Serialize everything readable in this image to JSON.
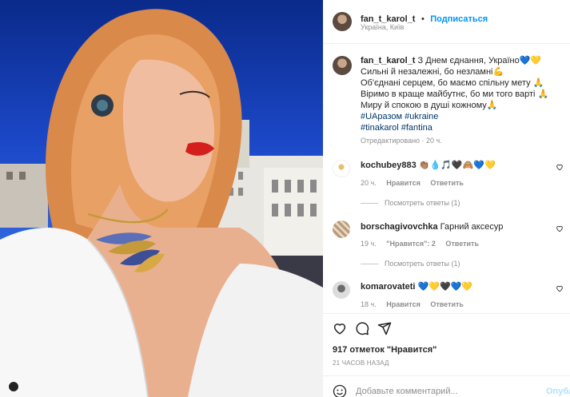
{
  "header": {
    "username": "fan_t_karol_t",
    "dot": "•",
    "follow": "Подписаться",
    "location": "Україна, Київ"
  },
  "caption": {
    "username": "fan_t_karol_t",
    "lines": [
      "З Днем єднання, Україно💙💛",
      "Сильні й незалежні, бо незламні💪",
      "Об'єднані серцем, бо маємо спільну мету 🙏",
      "Віримо в краще майбутнє, бо ми того варті 🙏",
      "Миру й спокою в душі кожному🙏"
    ],
    "hashtags_line1": "#UAразом #ukraine",
    "hashtags_line2": "#tinakarol #fantina",
    "meta": "Отредактировано · 20 ч."
  },
  "comments": [
    {
      "username": "kochubey883",
      "text": "👏🏽💧🎵🖤🙈💙💛",
      "time": "20 ч.",
      "like": "Нравится",
      "reply": "Ответить",
      "view_replies": "Посмотреть ответы (1)"
    },
    {
      "username": "borschagivovchka",
      "text": "Гарний аксесур",
      "time": "19 ч.",
      "like": "\"Нравится\": 2",
      "reply": "Ответить",
      "view_replies": "Посмотреть ответы (1)"
    },
    {
      "username": "komarovateti",
      "text": "💙💛🖤💙💛",
      "time": "18 ч.",
      "like": "Нравится",
      "reply": "Ответить"
    }
  ],
  "actions": {
    "likes": "917 отметок \"Нравится\"",
    "posted": "21 ЧАСОВ НАЗАД"
  },
  "composer": {
    "placeholder": "Добавьте комментарий...",
    "publish": "Опубл"
  },
  "colors": {
    "accent": "#0095f6",
    "hashtag": "#00376b",
    "muted": "#8e8e8e",
    "sky": "#1b47c6"
  },
  "icons": [
    "more-icon",
    "heart-icon",
    "comment-icon",
    "share-icon",
    "bookmark-icon",
    "emoji-icon"
  ]
}
